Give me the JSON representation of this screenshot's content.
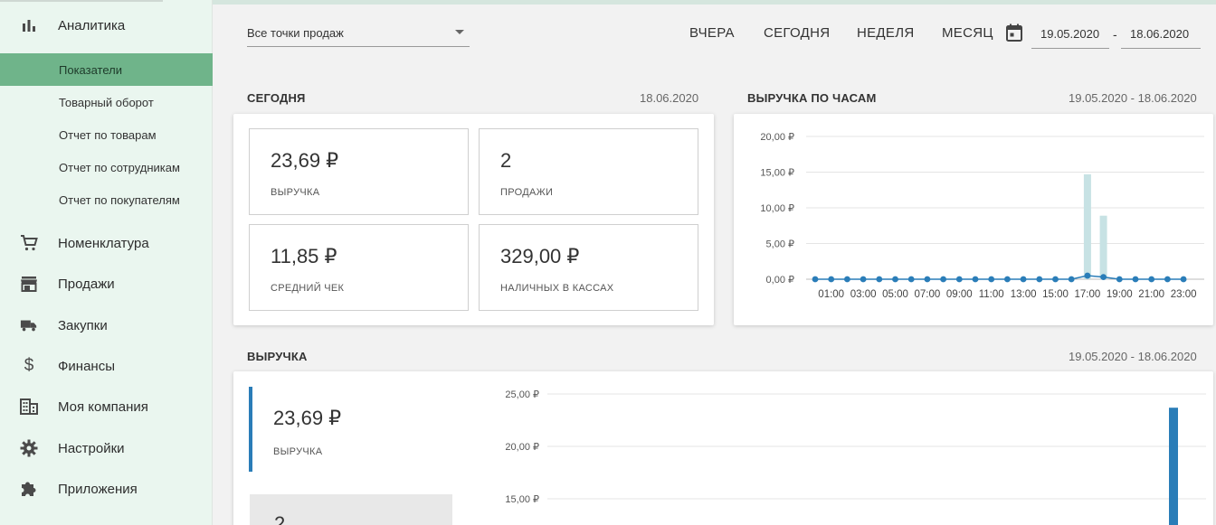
{
  "sidebar": {
    "analytics": {
      "label": "Аналитика",
      "icon": "bar-chart-icon"
    },
    "sub_items": [
      {
        "label": "Показатели",
        "active": true
      },
      {
        "label": "Товарный оборот",
        "active": false
      },
      {
        "label": "Отчет по товарам",
        "active": false
      },
      {
        "label": "Отчет по сотрудникам",
        "active": false
      },
      {
        "label": "Отчет по покупателям",
        "active": false
      }
    ],
    "items": [
      {
        "label": "Номенклатура",
        "icon": "cart-icon"
      },
      {
        "label": "Продажи",
        "icon": "store-icon"
      },
      {
        "label": "Закупки",
        "icon": "truck-icon"
      },
      {
        "label": "Финансы",
        "icon": "dollar-icon"
      },
      {
        "label": "Моя компания",
        "icon": "building-icon"
      },
      {
        "label": "Настройки",
        "icon": "gear-icon"
      },
      {
        "label": "Приложения",
        "icon": "puzzle-icon"
      }
    ]
  },
  "toolbar": {
    "store_select": "Все точки продаж",
    "periods": [
      "ВЧЕРА",
      "СЕГОДНЯ",
      "НЕДЕЛЯ",
      "МЕСЯЦ"
    ],
    "date_from": "19.05.2020",
    "date_to": "18.06.2020",
    "dash": "-"
  },
  "today": {
    "title": "СЕГОДНЯ",
    "date": "18.06.2020",
    "kpis": [
      {
        "value": "23,69 ₽",
        "caption": "ВЫРУЧКА"
      },
      {
        "value": "2",
        "caption": "ПРОДАЖИ"
      },
      {
        "value": "11,85 ₽",
        "caption": "СРЕДНИЙ ЧЕК"
      },
      {
        "value": "329,00 ₽",
        "caption": "НАЛИЧНЫХ В КАССАХ"
      }
    ]
  },
  "hourly": {
    "title": "ВЫРУЧКА ПО ЧАСАМ",
    "date": "19.05.2020 - 18.06.2020"
  },
  "revenue": {
    "title": "ВЫРУЧКА",
    "date": "19.05.2020 - 18.06.2020",
    "kpi_value": "23,69 ₽",
    "kpi_caption": "ВЫРУЧКА",
    "kpi2_value": "2"
  },
  "colors": {
    "accent_green": "#6fb48a",
    "bar_light": "#c7e2e4",
    "line_blue": "#2a7db8"
  },
  "chart_data": [
    {
      "type": "bar",
      "title": "ВЫРУЧКА ПО ЧАСАМ",
      "ylim": [
        0,
        20
      ],
      "y_ticks": [
        "0,00 ₽",
        "5,00 ₽",
        "10,00 ₽",
        "15,00 ₽",
        "20,00 ₽"
      ],
      "x_tick_labels": [
        "01:00",
        "03:00",
        "05:00",
        "07:00",
        "09:00",
        "11:00",
        "13:00",
        "15:00",
        "17:00",
        "19:00",
        "21:00",
        "23:00"
      ],
      "hours": [
        0,
        1,
        2,
        3,
        4,
        5,
        6,
        7,
        8,
        9,
        10,
        11,
        12,
        13,
        14,
        15,
        16,
        17,
        18,
        19,
        20,
        21,
        22,
        23
      ],
      "series": [
        {
          "values": [
            0,
            0,
            0,
            0,
            0,
            0,
            0,
            0,
            0,
            0,
            0,
            0,
            0,
            0,
            0,
            0,
            0,
            14.7,
            8.9,
            0,
            0,
            0,
            0,
            0
          ]
        },
        {
          "values": [
            0,
            0,
            0,
            0,
            0,
            0,
            0,
            0,
            0,
            0,
            0,
            0,
            0,
            0,
            0,
            0,
            0,
            0.5,
            0.3,
            0,
            0,
            0,
            0,
            0
          ]
        }
      ]
    },
    {
      "type": "bar",
      "title": "ВЫРУЧКА",
      "ylim": [
        0,
        25
      ],
      "y_ticks": [
        "15,00 ₽",
        "20,00 ₽",
        "25,00 ₽"
      ],
      "values": [
        23.69
      ]
    }
  ]
}
